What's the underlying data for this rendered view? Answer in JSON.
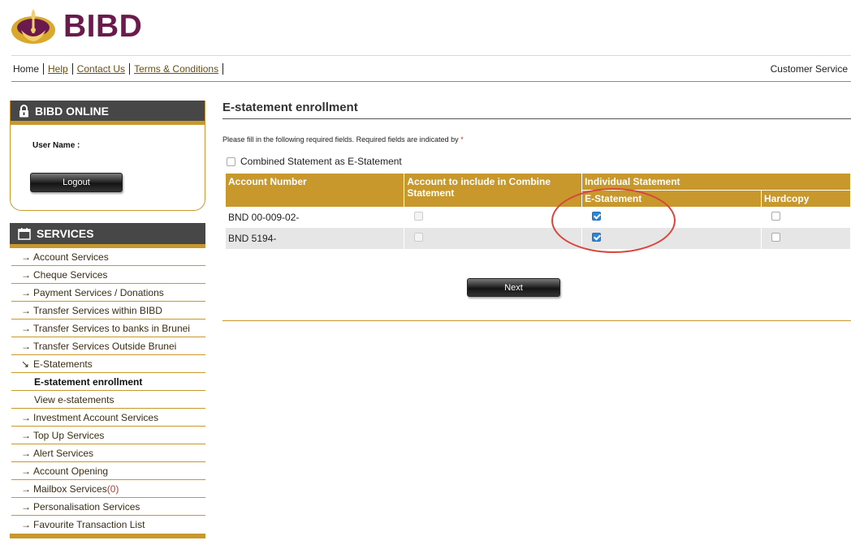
{
  "brand": {
    "name": "BIBD",
    "primary_color": "#6b1a4e",
    "accent_color": "#c8982c"
  },
  "topnav": {
    "items": [
      "Home",
      "Help",
      "Contact Us",
      "Terms & Conditions"
    ],
    "right": "Customer Service"
  },
  "login": {
    "title": "BIBD ONLINE",
    "user_label": "User Name :",
    "logout_label": "Logout"
  },
  "services": {
    "title": "SERVICES",
    "items": [
      "Account Services",
      "Cheque Services",
      "Payment Services / Donations",
      "Transfer Services within BIBD",
      "Transfer Services to banks in Brunei",
      "Transfer Services Outside Brunei",
      "E-Statements",
      "E-statement enrollment",
      "View e-statements",
      "Investment Account Services",
      "Top Up Services",
      "Alert Services",
      "Account Opening",
      "Mailbox Services",
      "Personalisation Services",
      "Favourite Transaction List"
    ],
    "mailbox_count": "(0)"
  },
  "main": {
    "title": "E-statement enrollment",
    "instruction": "Please fill in the following required fields. Required fields are indicated by",
    "required_mark": "*",
    "combined_label": "Combined Statement as E-Statement",
    "table": {
      "headers": {
        "account": "Account Number",
        "combine": "Account to include in Combine Statement",
        "individual": "Individual Statement",
        "estatement": "E-Statement",
        "hardcopy": "Hardcopy"
      },
      "rows": [
        {
          "account": "BND 00-009-02-",
          "combine": false,
          "estatement": true,
          "hardcopy": false
        },
        {
          "account": "BND 5194-",
          "combine": false,
          "estatement": true,
          "hardcopy": false
        }
      ]
    },
    "next_label": "Next"
  }
}
